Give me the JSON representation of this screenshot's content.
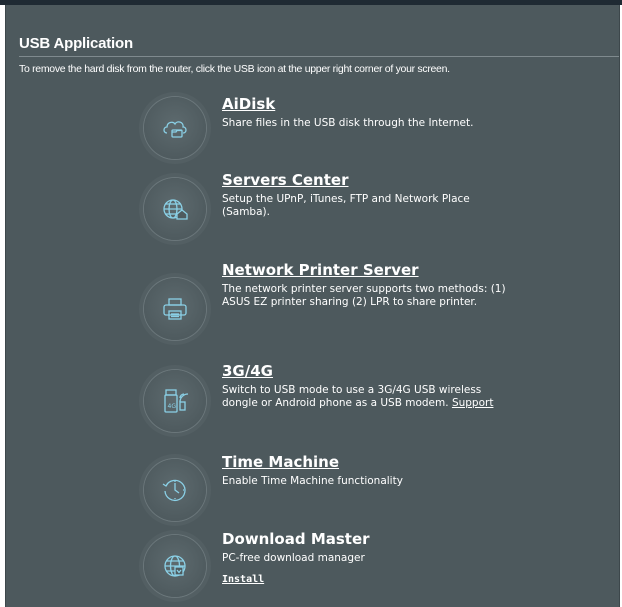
{
  "page": {
    "title": "USB Application",
    "subtitle": "To remove the hard disk from the router, click the USB icon at the upper right corner of your screen."
  },
  "items": [
    {
      "title": "AiDisk",
      "description": "Share files in the USB disk through the Internet.",
      "icon": "cloud-folder-icon"
    },
    {
      "title": "Servers Center",
      "description": "Setup the UPnP, iTunes, FTP and Network Place (Samba).",
      "icon": "globe-house-icon"
    },
    {
      "title": "Network Printer Server",
      "description": "The network printer server supports two methods: (1) ASUS EZ printer sharing (2) LPR to share printer.",
      "icon": "printer-icon"
    },
    {
      "title": "3G/4G",
      "description": "Switch to USB mode to use a 3G/4G USB wireless dongle or Android phone as a USB modem.",
      "link": "Support",
      "icon": "usb-modem-icon"
    },
    {
      "title": "Time Machine",
      "description": "Enable Time Machine functionality",
      "icon": "clock-icon"
    },
    {
      "title": "Download Master",
      "description": "PC-free download manager",
      "link": "Install",
      "icon": "globe-download-icon"
    }
  ],
  "colors": {
    "panel_bg": "#4d595d",
    "icon_stroke": "#8ad0e6",
    "text": "#ffffff"
  }
}
